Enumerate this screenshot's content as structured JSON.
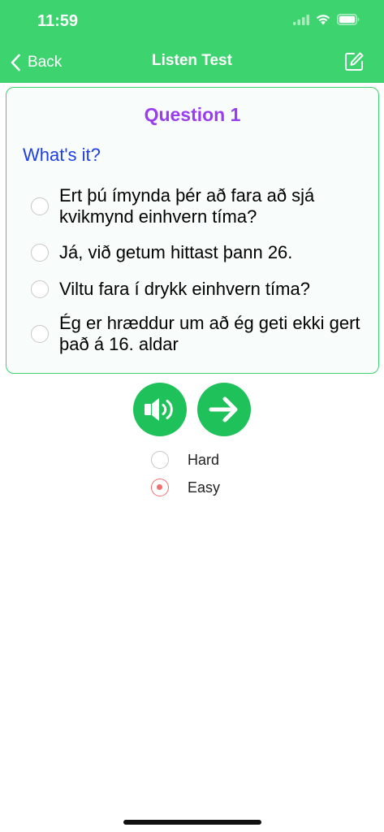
{
  "status": {
    "time": "11:59"
  },
  "nav": {
    "back_label": "Back",
    "title": "Listen Test"
  },
  "question": {
    "number_label": "Question 1",
    "prompt": "What's it?",
    "options": [
      {
        "text": "Ert þú ímynda þér að fara að sjá kvikmynd einhvern tíma?",
        "selected": false
      },
      {
        "text": "Já, við getum hittast þann 26.",
        "selected": false
      },
      {
        "text": "Viltu fara í drykk einhvern tíma?",
        "selected": false
      },
      {
        "text": "Ég er hræddur um að ég geti ekki gert það á 16. aldar",
        "selected": false
      }
    ]
  },
  "controls": {
    "speaker_icon": "speaker-icon",
    "next_icon": "arrow-right-icon"
  },
  "difficulty": {
    "options": [
      {
        "label": "Hard",
        "selected": false
      },
      {
        "label": "Easy",
        "selected": true
      }
    ]
  },
  "colors": {
    "header": "#3dd36e",
    "button": "#1fc25a",
    "question_title": "#9a3df0",
    "prompt": "#1e3ee6",
    "selected_radio": "#f26f6f"
  }
}
